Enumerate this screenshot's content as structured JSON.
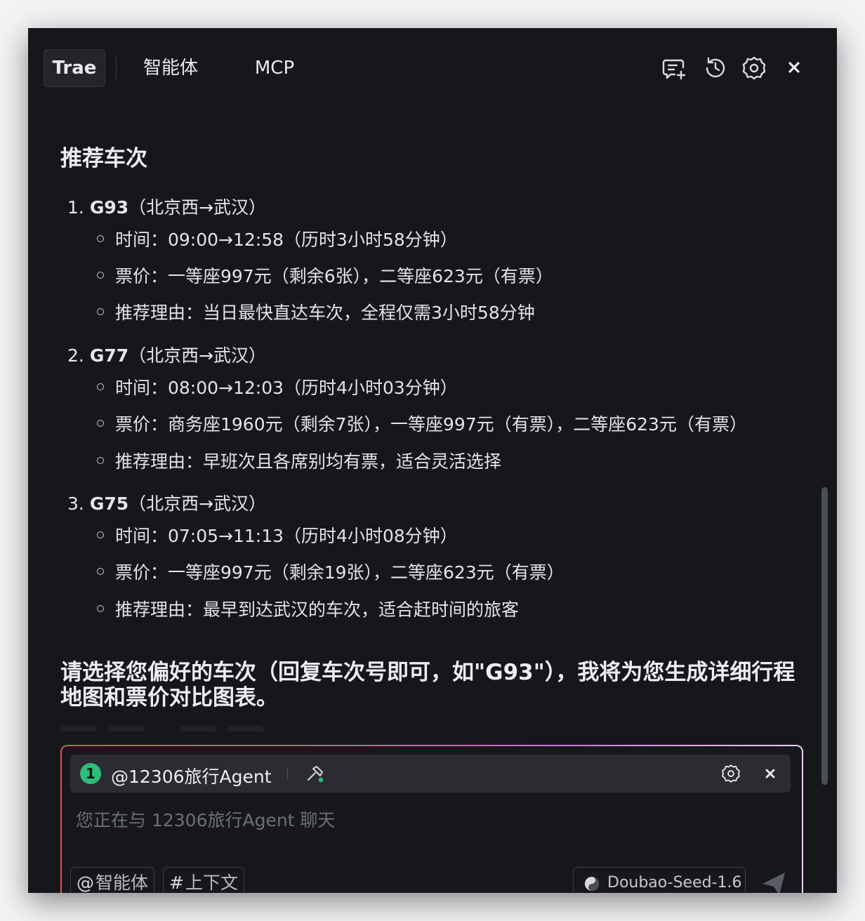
{
  "tabs": [
    {
      "label": "Trae"
    },
    {
      "label": "智能体"
    },
    {
      "label": "MCP"
    }
  ],
  "header_icons": [
    "new-chat-icon",
    "history-icon",
    "settings-icon",
    "close-icon"
  ],
  "content": {
    "section_title": "推荐车次",
    "trains": [
      {
        "index": "1.",
        "number": "G93",
        "route": "（北京西→武汉）",
        "bullets": [
          "时间：09:00→12:58（历时3小时58分钟）",
          "票价：一等座997元（剩余6张），二等座623元（有票）",
          "推荐理由：当日最快直达车次，全程仅需3小时58分钟"
        ]
      },
      {
        "index": "2.",
        "number": "G77",
        "route": "（北京西→武汉）",
        "bullets": [
          "时间：08:00→12:03（历时4小时03分钟）",
          "票价：商务座1960元（剩余7张），一等座997元（有票），二等座623元（有票）",
          "推荐理由：早班次且各席别均有票，适合灵活选择"
        ]
      },
      {
        "index": "3.",
        "number": "G75",
        "route": "（北京西→武汉）",
        "bullets": [
          "时间：07:05→11:13（历时4小时08分钟）",
          "票价：一等座997元（剩余19张），二等座623元（有票）",
          "推荐理由：最早到达武汉的车次，适合赶时间的旅客"
        ]
      }
    ],
    "closing_text": "请选择您偏好的车次（回复车次号即可，如\"G93\"），我将为您生成详细行程地图和票价对比图表。"
  },
  "input": {
    "agent_badge": "1",
    "agent_name": "@12306旅行Agent",
    "placeholder": "您正在与 12306旅行Agent 聊天",
    "chips": [
      {
        "symbol": "@",
        "label": "智能体"
      },
      {
        "symbol": "#",
        "label": "上下文"
      }
    ],
    "model": "Doubao-Seed-1.6"
  },
  "colors": {
    "background": "#16171b",
    "accent_green": "#2ebd7a",
    "border_gradient_start": "#e4534f",
    "border_gradient_end": "#e9d3f1"
  }
}
